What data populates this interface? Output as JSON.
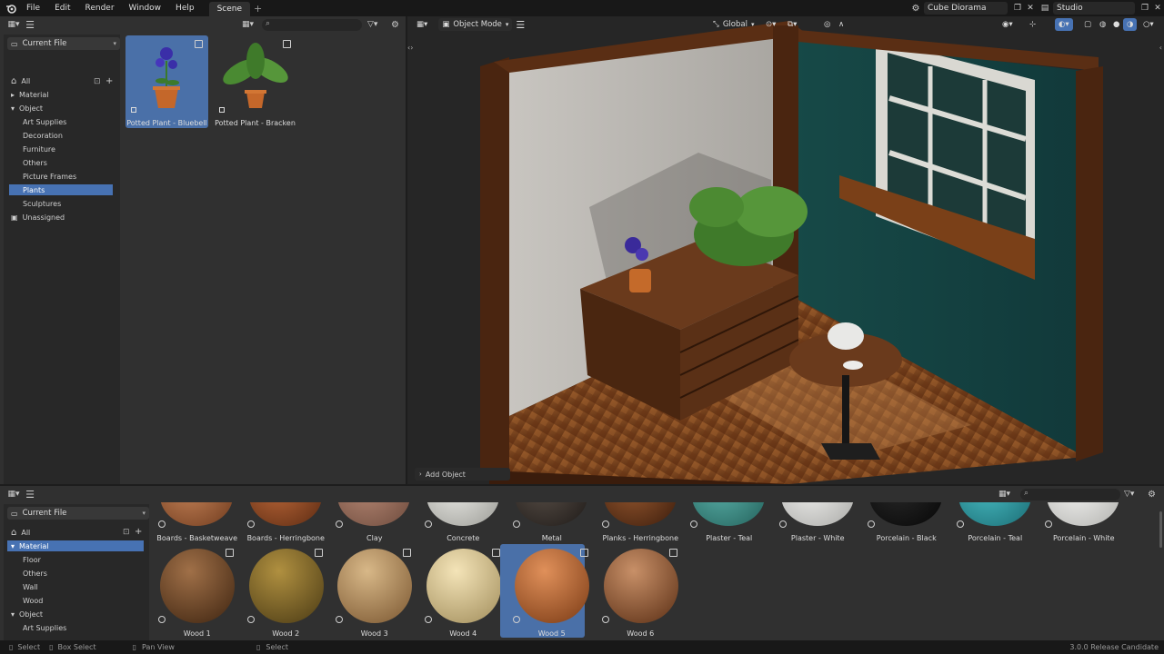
{
  "menubar": {
    "items": [
      "File",
      "Edit",
      "Render",
      "Window",
      "Help"
    ],
    "workspace_tab": "Scene",
    "add_tab": "+",
    "scene_name": "Cube Diorama",
    "view_layer": "Studio"
  },
  "top_browser": {
    "library": "Current File",
    "categories": [
      {
        "label": "All",
        "level": 0,
        "selected": false,
        "expandable": false
      },
      {
        "label": "Material",
        "level": 0,
        "selected": false,
        "expandable": true,
        "expanded": false
      },
      {
        "label": "Object",
        "level": 0,
        "selected": false,
        "expandable": true,
        "expanded": true
      },
      {
        "label": "Art Supplies",
        "level": 1,
        "selected": false
      },
      {
        "label": "Decoration",
        "level": 1,
        "selected": false
      },
      {
        "label": "Furniture",
        "level": 1,
        "selected": false
      },
      {
        "label": "Others",
        "level": 1,
        "selected": false
      },
      {
        "label": "Picture Frames",
        "level": 1,
        "selected": false
      },
      {
        "label": "Plants",
        "level": 1,
        "selected": true
      },
      {
        "label": "Sculptures",
        "level": 1,
        "selected": false
      },
      {
        "label": "Unassigned",
        "level": 0,
        "selected": false
      }
    ],
    "assets": [
      {
        "label": "Potted Plant - Bluebell",
        "selected": true
      },
      {
        "label": "Potted Plant - Bracken",
        "selected": false
      }
    ]
  },
  "viewport": {
    "mode": "Object Mode",
    "orientation": "Global",
    "add_object": "Add Object"
  },
  "bottom_browser": {
    "library": "Current File",
    "categories": [
      {
        "label": "All",
        "level": 0,
        "selected": false
      },
      {
        "label": "Material",
        "level": 0,
        "selected": true,
        "expandable": true,
        "expanded": true
      },
      {
        "label": "Floor",
        "level": 1,
        "selected": false
      },
      {
        "label": "Others",
        "level": 1,
        "selected": false
      },
      {
        "label": "Wall",
        "level": 1,
        "selected": false
      },
      {
        "label": "Wood",
        "level": 1,
        "selected": false
      },
      {
        "label": "Object",
        "level": 0,
        "selected": false,
        "expandable": true,
        "expanded": true
      },
      {
        "label": "Art Supplies",
        "level": 1,
        "selected": false
      }
    ],
    "materials_row1": [
      {
        "label": "Boards - Basketweave",
        "color1": "#c9865a",
        "color2": "#6e3a1d"
      },
      {
        "label": "Boards - Herringbone",
        "color1": "#c06a3a",
        "color2": "#5a2a12"
      },
      {
        "label": "Clay",
        "color1": "#b98a76",
        "color2": "#6c4a3c"
      },
      {
        "label": "Concrete",
        "color1": "#efefea",
        "color2": "#9a9a95"
      },
      {
        "label": "Metal",
        "color1": "#5a5048",
        "color2": "#1e1a18"
      },
      {
        "label": "Planks - Herringbone",
        "color1": "#9a5a30",
        "color2": "#3a1c0c"
      },
      {
        "label": "Plaster - Teal",
        "color1": "#5cb4ac",
        "color2": "#23605a"
      },
      {
        "label": "Plaster - White",
        "color1": "#f4f4f2",
        "color2": "#a8a8a5"
      },
      {
        "label": "Porcelain - Black",
        "color1": "#2a2a2a",
        "color2": "#060606"
      },
      {
        "label": "Porcelain - Teal",
        "color1": "#4ac0c6",
        "color2": "#1a6a72"
      },
      {
        "label": "Porcelain - White",
        "color1": "#f8f8f6",
        "color2": "#b0b0ad"
      }
    ],
    "materials_row2": [
      {
        "label": "Wood 1",
        "color1": "#a07048",
        "color2": "#3e2410",
        "selected": false
      },
      {
        "label": "Wood 2",
        "color1": "#b09040",
        "color2": "#4a3a14",
        "selected": false
      },
      {
        "label": "Wood 3",
        "color1": "#d8b888",
        "color2": "#7a5630",
        "selected": false
      },
      {
        "label": "Wood 4",
        "color1": "#f4e4b8",
        "color2": "#a08c5a",
        "selected": false
      },
      {
        "label": "Wood 5",
        "color1": "#e0905a",
        "color2": "#7a3a14",
        "selected": true
      },
      {
        "label": "Wood 6",
        "color1": "#c89068",
        "color2": "#5a2e14",
        "selected": false
      }
    ]
  },
  "statusbar": {
    "select": "Select",
    "box_select": "Box Select",
    "pan_view": "Pan View",
    "select2": "Select",
    "version": "3.0.0 Release Candidate"
  }
}
